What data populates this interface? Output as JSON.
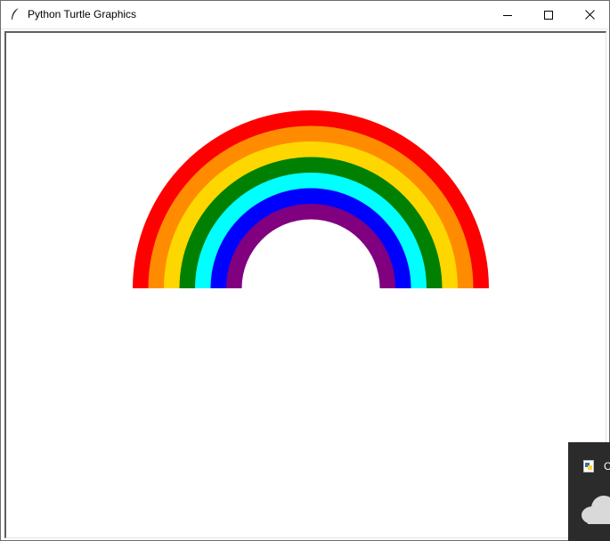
{
  "window": {
    "title": "Python Turtle Graphics",
    "controls": {
      "minimize": "minimize-icon",
      "maximize": "maximize-icon",
      "close": "close-icon"
    }
  },
  "canvas": {
    "background": "#ffffff",
    "rainbow": {
      "bands": [
        {
          "color": "#ff0000"
        },
        {
          "color": "#ff8c00"
        },
        {
          "color": "#ffd700"
        },
        {
          "color": "#008000"
        },
        {
          "color": "#00ffff"
        },
        {
          "color": "#0000ff"
        },
        {
          "color": "#800080"
        }
      ]
    }
  },
  "notification": {
    "text": "C",
    "icon": "onedrive-cloud-icon",
    "background": "#2b2b2b"
  }
}
